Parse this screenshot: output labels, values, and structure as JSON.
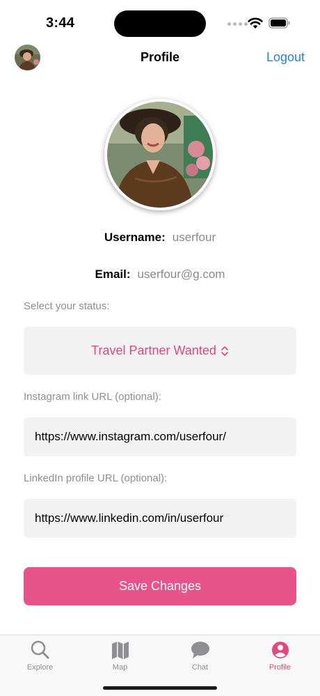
{
  "status_bar": {
    "time": "3:44",
    "icons": [
      "cellular-dots-icon",
      "wifi-icon",
      "battery-icon"
    ]
  },
  "nav": {
    "title": "Profile",
    "logout_label": "Logout"
  },
  "profile": {
    "username_label": "Username:",
    "username_value": "userfour",
    "email_label": "Email:",
    "email_value": "userfour@g.com"
  },
  "form": {
    "status_label": "Select your status:",
    "status_value": "Travel Partner Wanted",
    "instagram_label": "Instagram link URL (optional):",
    "instagram_value": "https://www.instagram.com/userfour/",
    "linkedin_label": "LinkedIn profile URL (optional):",
    "linkedin_value": "https://www.linkedin.com/in/userfour",
    "save_label": "Save Changes"
  },
  "tabs": [
    {
      "label": "Explore",
      "icon": "search-icon"
    },
    {
      "label": "Map",
      "icon": "map-icon"
    },
    {
      "label": "Chat",
      "icon": "chat-bubble-icon"
    },
    {
      "label": "Profile",
      "icon": "user-circle-icon",
      "active": true
    }
  ],
  "colors": {
    "accent": "#e4477f",
    "button": "#e8538a",
    "link": "#1f82e8",
    "field_bg": "#f2f2f2",
    "muted": "#8e8e93"
  }
}
